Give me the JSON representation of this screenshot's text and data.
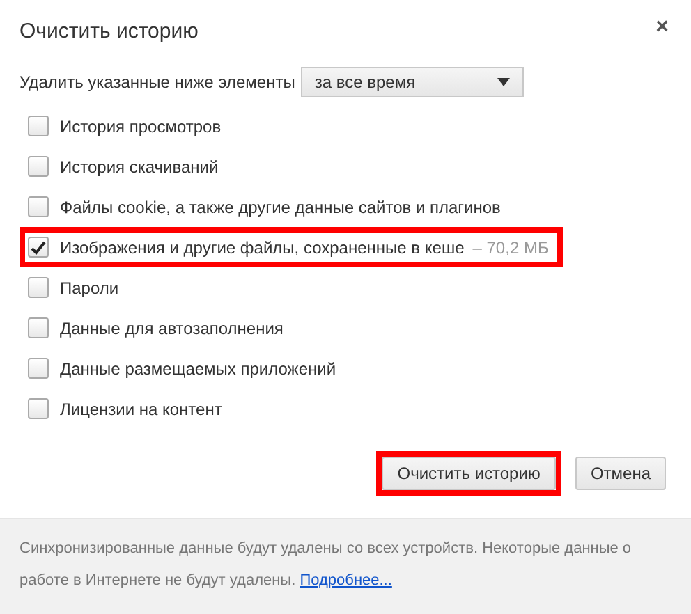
{
  "dialog": {
    "title": "Очистить историю",
    "close": "×"
  },
  "range": {
    "label": "Удалить указанные ниже элементы",
    "value": "за все время"
  },
  "items": [
    {
      "label": "История просмотров",
      "checked": false,
      "highlighted": false
    },
    {
      "label": "История скачиваний",
      "checked": false,
      "highlighted": false
    },
    {
      "label": "Файлы cookie, а также другие данные сайтов и плагинов",
      "checked": false,
      "highlighted": false
    },
    {
      "label": "Изображения и другие файлы, сохраненные в кеше",
      "size": "–  70,2 МБ",
      "checked": true,
      "highlighted": true
    },
    {
      "label": "Пароли",
      "checked": false,
      "highlighted": false
    },
    {
      "label": "Данные для автозаполнения",
      "checked": false,
      "highlighted": false
    },
    {
      "label": "Данные размещаемых приложений",
      "checked": false,
      "highlighted": false
    },
    {
      "label": "Лицензии на контент",
      "checked": false,
      "highlighted": false
    }
  ],
  "buttons": [
    {
      "label": "Очистить историю",
      "highlighted": true
    },
    {
      "label": "Отмена",
      "highlighted": false
    }
  ],
  "footer": {
    "text": "Синхронизированные данные будут удалены со всех устройств. Некоторые данные о работе в Интернете не будут удалены.",
    "link": "Подробнее..."
  }
}
